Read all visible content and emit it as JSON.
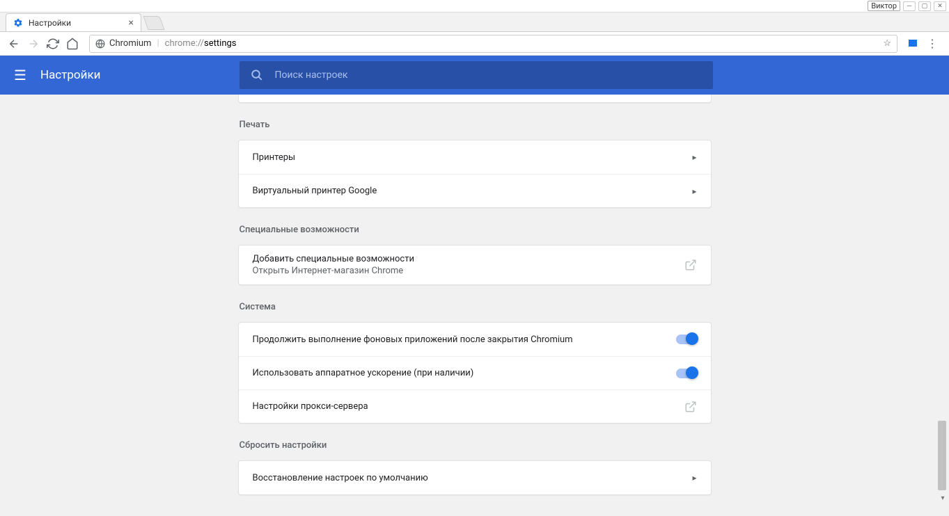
{
  "window": {
    "user_label": "Виктор"
  },
  "tab": {
    "title": "Настройки"
  },
  "omnibox": {
    "site": "Chromium",
    "url_prefix": "chrome://",
    "url_path": "settings"
  },
  "header": {
    "title": "Настройки",
    "search_placeholder": "Поиск настроек"
  },
  "sections": {
    "print": {
      "title": "Печать",
      "rows": {
        "printers": "Принтеры",
        "cloud_print": "Виртуальный принтер Google"
      }
    },
    "accessibility": {
      "title": "Специальные возможности",
      "add_label": "Добавить специальные возможности",
      "add_sub": "Открыть Интернет-магазин Chrome"
    },
    "system": {
      "title": "Система",
      "background_apps": "Продолжить выполнение фоновых приложений после закрытия Chromium",
      "hardware_accel": "Использовать аппаратное ускорение (при наличии)",
      "proxy": "Настройки прокси-сервера"
    },
    "reset": {
      "title": "Сбросить настройки",
      "restore": "Восстановление настроек по умолчанию"
    }
  }
}
